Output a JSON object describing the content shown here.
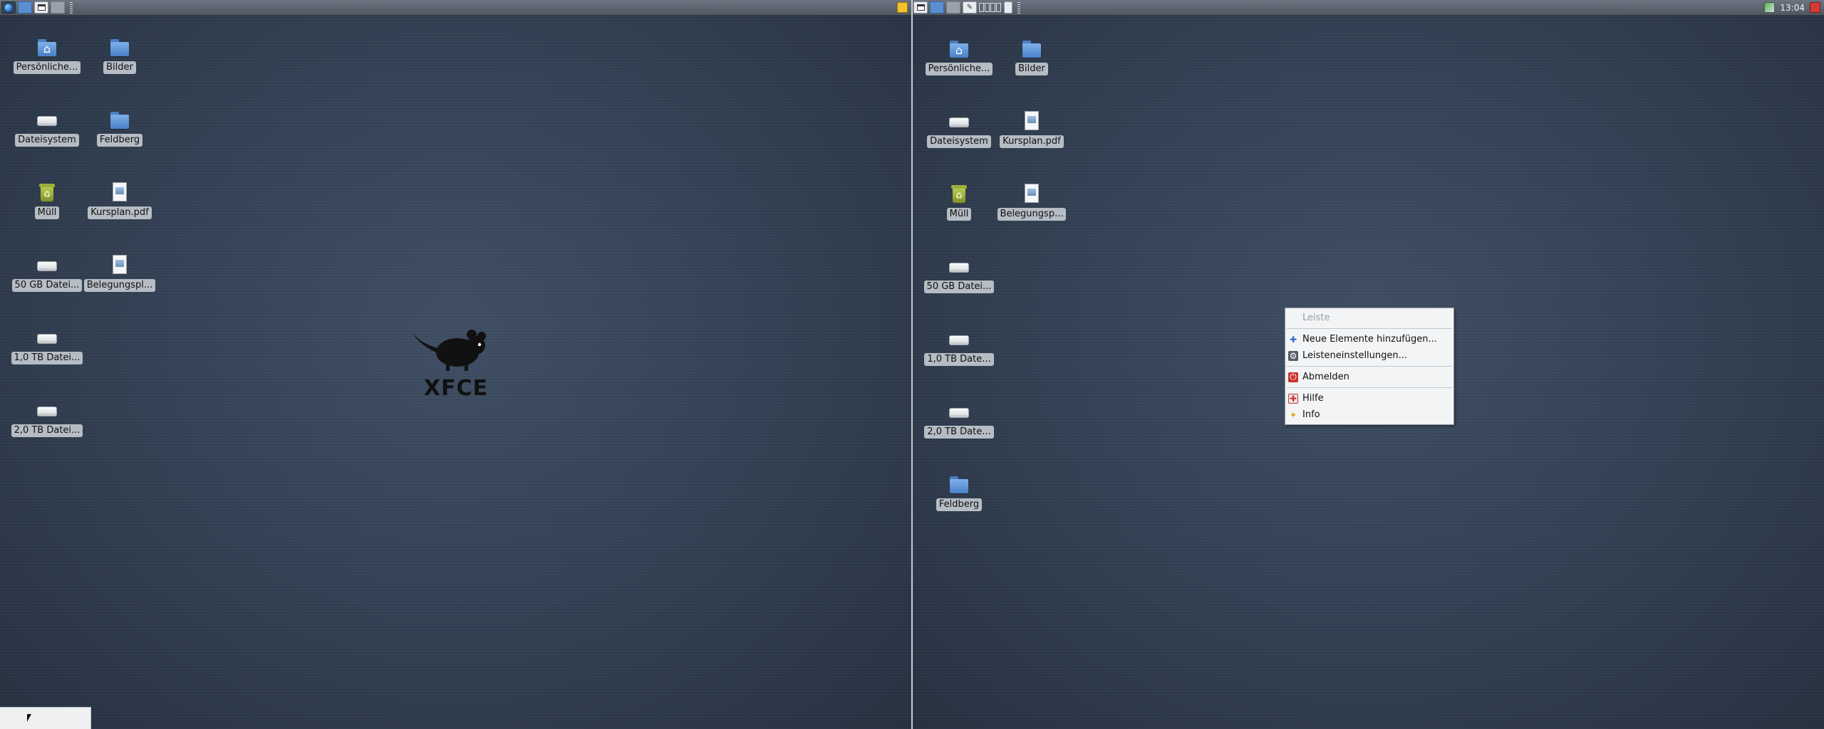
{
  "left_screen": {
    "desktop_icons": [
      {
        "label": "Persönliche...",
        "icon": "home-folder-icon"
      },
      {
        "label": "Bilder",
        "icon": "folder-icon"
      },
      {
        "label": "Dateisystem",
        "icon": "drive-icon"
      },
      {
        "label": "Feldberg",
        "icon": "folder-icon"
      },
      {
        "label": "Müll",
        "icon": "trash-icon"
      },
      {
        "label": "Kursplan.pdf",
        "icon": "document-icon"
      },
      {
        "label": "50 GB Datei...",
        "icon": "drive-icon"
      },
      {
        "label": "Belegungspl...",
        "icon": "document-icon"
      },
      {
        "label": "1,0 TB Datei...",
        "icon": "drive-icon"
      },
      {
        "label": "2,0 TB Datei...",
        "icon": "drive-icon"
      }
    ],
    "logo_text": "XFCE"
  },
  "right_screen": {
    "clock": "13:04",
    "desktop_icons": [
      {
        "label": "Persönliche...",
        "icon": "home-folder-icon"
      },
      {
        "label": "Bilder",
        "icon": "folder-icon"
      },
      {
        "label": "Dateisystem",
        "icon": "drive-icon"
      },
      {
        "label": "Kursplan.pdf",
        "icon": "document-icon"
      },
      {
        "label": "Müll",
        "icon": "trash-icon"
      },
      {
        "label": "Belegungsp...",
        "icon": "document-icon"
      },
      {
        "label": "50 GB Datei...",
        "icon": "drive-icon"
      },
      {
        "label": "1,0 TB Date...",
        "icon": "drive-icon"
      },
      {
        "label": "2,0 TB Date...",
        "icon": "drive-icon"
      },
      {
        "label": "Feldberg",
        "icon": "folder-icon"
      }
    ]
  },
  "context_menu": {
    "title": "Leiste",
    "items": [
      {
        "label": "Neue Elemente hinzufügen...",
        "icon": "add-icon"
      },
      {
        "label": "Leisteneinstellungen...",
        "icon": "settings-icon"
      },
      {
        "label": "Abmelden",
        "icon": "logout-icon"
      },
      {
        "label": "Hilfe",
        "icon": "help-icon"
      },
      {
        "label": "Info",
        "icon": "info-icon"
      }
    ]
  },
  "colors": {
    "desktop_bg": "#344256",
    "panel_bg": "#5b636e",
    "menu_bg": "#f3f4f5"
  }
}
